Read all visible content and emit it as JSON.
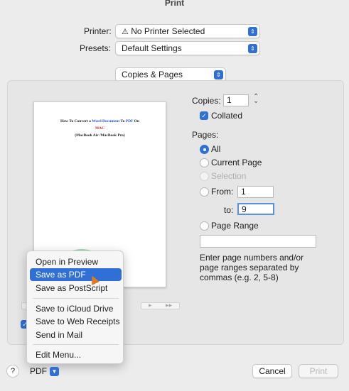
{
  "window": {
    "title": "Print"
  },
  "printer": {
    "label": "Printer:",
    "value": "No Printer Selected"
  },
  "presets": {
    "label": "Presets:",
    "value": "Default Settings"
  },
  "section": {
    "value": "Copies & Pages"
  },
  "preview": {
    "line1_a": "How To Convert a ",
    "line1_b": "Word Document",
    "line1_c": " To ",
    "line1_d": "PDF",
    "line1_e": " On",
    "line2": "MAC",
    "line3": "(MacBook Air /MacBook Pro)"
  },
  "copies": {
    "label": "Copies:",
    "value": "1",
    "collated_label": "Collated",
    "collated": true
  },
  "pages": {
    "label": "Pages:",
    "all": "All",
    "current": "Current Page",
    "selection": "Selection",
    "from_label": "From:",
    "from_value": "1",
    "to_label": "to:",
    "to_value": "9",
    "range_label": "Page Range",
    "hint": "Enter page numbers and/or page ranges separated by commas (e.g. 2, 5-8)"
  },
  "pdf_menu": {
    "items": [
      "Open in Preview",
      "Save as PDF",
      "Save as PostScript",
      "Save to iCloud Drive",
      "Save to Web Receipts",
      "Send in Mail",
      "Edit Menu..."
    ],
    "selected": "Save as PDF"
  },
  "footer": {
    "help": "?",
    "pdf": "PDF",
    "cancel": "Cancel",
    "print": "Print"
  },
  "nav": {
    "next": "▶",
    "last": "▶▶"
  },
  "colors": {
    "accent": "#2f6fd6",
    "highlight": "#4cbe6e"
  }
}
